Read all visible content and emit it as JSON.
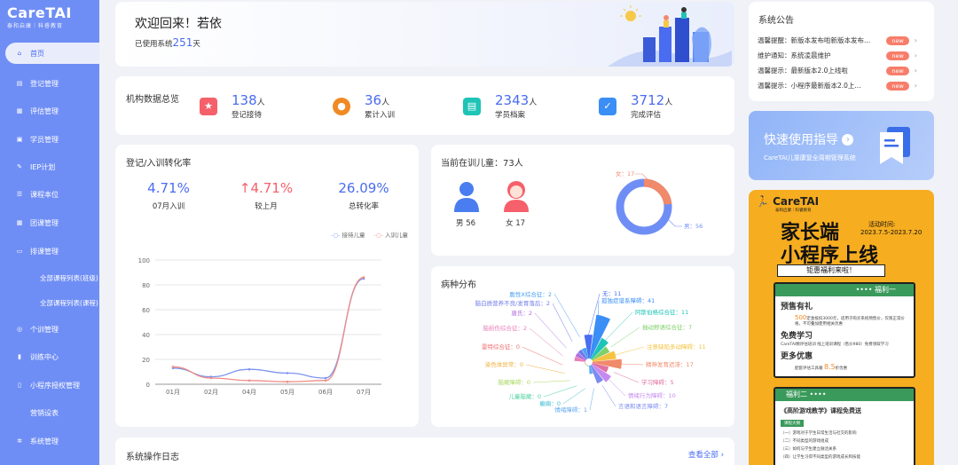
{
  "logo": {
    "title": "CareTAI",
    "subtitle": "泰和启康｜科睿教育"
  },
  "nav": [
    {
      "label": "首页",
      "icon": "home-icon",
      "active": true
    },
    {
      "label": "登记管理",
      "icon": "register-icon"
    },
    {
      "label": "评估管理",
      "icon": "assessment-icon"
    },
    {
      "label": "学员管理",
      "icon": "student-icon"
    },
    {
      "label": "IEP计划",
      "icon": "edit-icon"
    },
    {
      "label": "课程本位",
      "icon": "list-icon"
    },
    {
      "label": "团课管理",
      "icon": "grid-icon"
    },
    {
      "label": "排课管理",
      "icon": "schedule-icon"
    }
  ],
  "nav_sub": [
    "全部课程列表(班级)",
    "全部课程列表(课程)"
  ],
  "nav2": [
    {
      "label": "个训管理",
      "icon": "individual-icon"
    },
    {
      "label": "训练中心",
      "icon": "chart-icon"
    },
    {
      "label": "小程序授权管理",
      "icon": "phone-icon"
    },
    {
      "label": "营销设表",
      "icon": "marketing-icon"
    },
    {
      "label": "系统管理",
      "icon": "gear-icon"
    }
  ],
  "welcome": {
    "greeting": "欢迎回来！若依",
    "days_prefix": "已使用系统",
    "days": "251",
    "days_suffix": "天"
  },
  "overview": {
    "title": "机构数据总览",
    "stats": [
      {
        "value": "138",
        "unit": "人",
        "label": "登记接待",
        "icon": "user-star-icon",
        "color": "#f5606a"
      },
      {
        "value": "36",
        "unit": "人",
        "label": "累计入训",
        "icon": "users-icon",
        "color": "#f08a24"
      },
      {
        "value": "2343",
        "unit": "人",
        "label": "学员档案",
        "icon": "folder-icon",
        "color": "#1ec4b6"
      },
      {
        "value": "3712",
        "unit": "人",
        "label": "完成评估",
        "icon": "clipboard-check-icon",
        "color": "#3a8ef6"
      }
    ]
  },
  "conversion": {
    "title": "登记/入训转化率",
    "kpis": [
      {
        "value": "4.71%",
        "label": "07月入训"
      },
      {
        "value": "4.71%",
        "label": "较上月",
        "arrow": "↑"
      },
      {
        "value": "26.09%",
        "label": "总转化率"
      }
    ]
  },
  "chart_data": {
    "type": "line",
    "categories": [
      "01月",
      "02月",
      "04月",
      "05月",
      "06月",
      "07月"
    ],
    "series": [
      {
        "name": "接待儿童",
        "color": "#7d95ee",
        "values": [
          13,
          6,
          12,
          9,
          5,
          85
        ]
      },
      {
        "name": "入训儿童",
        "color": "#ef8c84",
        "values": [
          14,
          5,
          3,
          2,
          3,
          86
        ]
      }
    ],
    "ylim": [
      0,
      100
    ],
    "yticks": [
      "100",
      "80",
      "60",
      "40",
      "20",
      "0"
    ]
  },
  "training": {
    "title": "当前在训儿童：73人",
    "male": "男 56",
    "female": "女 17",
    "donut_female": "女：17",
    "donut_male": "男：56",
    "male_value": 56,
    "female_value": 17
  },
  "disease": {
    "title": "病种分布",
    "labels": [
      {
        "t": "无：11",
        "c": "#4a6cf0"
      },
      {
        "t": "孤独症谱系障碍：41",
        "c": "#3a8ef6"
      },
      {
        "t": "阿斯伯格综合征：11",
        "c": "#1ec4b6"
      },
      {
        "t": "抽动秽语综合征：7",
        "c": "#7fd06b"
      },
      {
        "t": "注意缺陷多动障碍：11",
        "c": "#f5c342"
      },
      {
        "t": "精神发育迟滞：17",
        "c": "#f08a6a"
      },
      {
        "t": "学习障碍：5",
        "c": "#e070a0"
      },
      {
        "t": "情绪行为障碍：10",
        "c": "#c58af0"
      },
      {
        "t": "言语和语言障碍：7",
        "c": "#7b8cf0"
      },
      {
        "t": "情绪障碍：1",
        "c": "#5fa8f0"
      },
      {
        "t": "癫痫：0",
        "c": "#3bbfd0"
      },
      {
        "t": "儿童脑瘫：0",
        "c": "#4ed0a0"
      },
      {
        "t": "脑瘫障碍：0",
        "c": "#a8d860"
      },
      {
        "t": "染色体异常：0",
        "c": "#f0b040"
      },
      {
        "t": "雷特综合征：0",
        "c": "#f07070"
      },
      {
        "t": "脑损伤综合征：2",
        "c": "#e87fb8"
      },
      {
        "t": "唐氏：2",
        "c": "#b06ee0"
      },
      {
        "t": "脑白质营养不良/发育落后：2",
        "c": "#6e7ae8"
      },
      {
        "t": "脆性X综合征：2",
        "c": "#4aa0f0"
      }
    ]
  },
  "logs": {
    "title": "系统操作日志",
    "view_all": "查看全部"
  },
  "notice": {
    "title": "系统公告",
    "items": [
      {
        "text": "温馨提醒：新版本发布啦新版本发布...",
        "badge": "new"
      },
      {
        "text": "维护通知：系统凌晨维护",
        "badge": "new"
      },
      {
        "text": "温馨提示：最新版本2.0上线啦",
        "badge": "new"
      },
      {
        "text": "温馨提示：小程序最新版本2.0上...",
        "badge": "new"
      }
    ]
  },
  "guide": {
    "title": "快速使用指导",
    "subtitle": "CareTAI儿童康复全周期管理系统"
  },
  "promo": {
    "brand": "CareTAI",
    "brand_sub": "泰和启康｜科睿教育",
    "line1": "家长端",
    "line2": "小程序上线",
    "period_label": "活动时间:",
    "period": "2023.7.5-2023.7.20",
    "banner": "钜惠福利来啦！",
    "welfare1": "福利一",
    "w1_t1": "预售有礼",
    "w1_d1a": "500",
    "w1_d1": "定金抵扣3000元，适用于购买系统预售价，仅限正常价格，不可叠加使用相关优惠",
    "w1_t2": "免费学习",
    "w1_d2": "CareTAI精评估培训 线上培训课程（售价980）免费领取学习",
    "w1_d2a": "980",
    "w1_t3": "更多优惠",
    "w1_d3": "配套评估工具箱",
    "w1_d3a": "8.5",
    "w1_d3b": "折优惠",
    "welfare2": "福利二",
    "w2_title": "《高阶游戏教学》课程免费送",
    "w2_tag": "课程大纲",
    "w2_items": [
      "（一）游戏对于学生日常生活与社交的影响",
      "（二）不同类型的游戏组成",
      "（三）如何与学生建立融洽关系",
      "（四）让学生习得不同类型的游戏成长和技能"
    ]
  }
}
